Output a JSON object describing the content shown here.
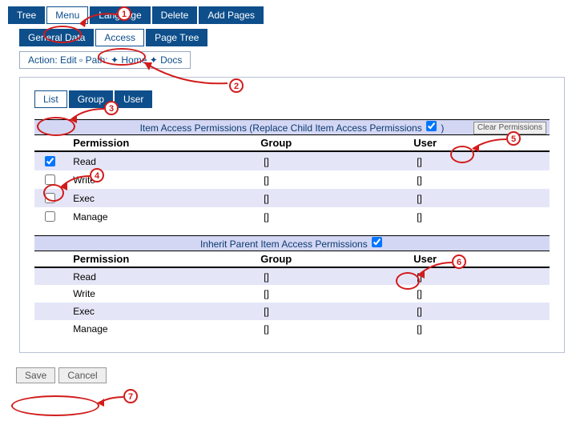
{
  "topTabs": {
    "tree": "Tree",
    "menu": "Menu",
    "language": "Language",
    "delete": "Delete",
    "addPages": "Add Pages"
  },
  "menuTabs": {
    "generalData": "General Data",
    "access": "Access",
    "pageTree": "Page Tree"
  },
  "breadcrumb": "Action: Edit ▫ Path: ✦ Home ✦ Docs",
  "subTabs": {
    "list": "List",
    "group": "Group",
    "user": "User"
  },
  "permHeader1": "Item Access Permissions (Replace Child Item Access Permissions",
  "permHeader1Suffix": ")",
  "clearPermissions": "Clear Permissions",
  "permHeader2": "Inherit Parent Item Access Permissions",
  "columns": {
    "permission": "Permission",
    "group": "Group",
    "user": "User"
  },
  "rows1": [
    {
      "name": "Read",
      "checked": true,
      "group": "[]",
      "user": "[]"
    },
    {
      "name": "Write",
      "checked": false,
      "group": "[]",
      "user": "[]"
    },
    {
      "name": "Exec",
      "checked": false,
      "group": "[]",
      "user": "[]"
    },
    {
      "name": "Manage",
      "checked": false,
      "group": "[]",
      "user": "[]"
    }
  ],
  "rows2": [
    {
      "name": "Read",
      "group": "[]",
      "user": "[]"
    },
    {
      "name": "Write",
      "group": "[]",
      "user": "[]"
    },
    {
      "name": "Exec",
      "group": "[]",
      "user": "[]"
    },
    {
      "name": "Manage",
      "group": "[]",
      "user": "[]"
    }
  ],
  "header1Checked": true,
  "header2Checked": true,
  "actions": {
    "save": "Save",
    "cancel": "Cancel"
  },
  "annotations": {
    "1": "1",
    "2": "2",
    "3": "3",
    "4": "4",
    "5": "5",
    "6": "6",
    "7": "7"
  }
}
